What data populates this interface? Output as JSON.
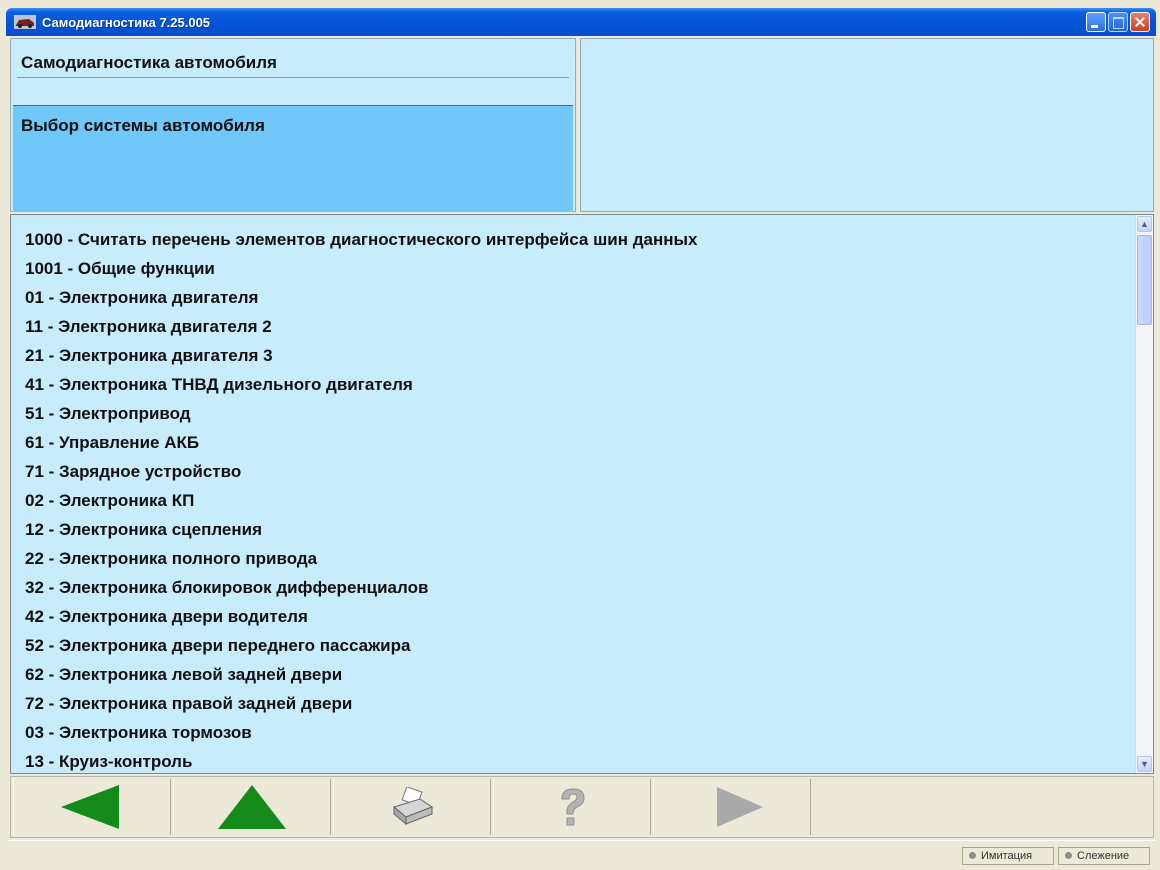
{
  "window": {
    "title": "Самодиагностика 7.25.005"
  },
  "header": {
    "title": "Самодиагностика автомобиля",
    "selected": "Выбор системы автомобиля"
  },
  "list": {
    "items": [
      "1000 - Считать перечень элементов диагностического интерфейса шин данных",
      "1001 - Общие функции",
      "01 - Электроника двигателя",
      "11 - Электроника двигателя 2",
      "21 - Электроника двигателя 3",
      "41 - Электроника ТНВД дизельного двигателя",
      "51 - Электропривод",
      "61 - Управление АКБ",
      "71 - Зарядное устройство",
      "02 - Электроника КП",
      "12 - Электроника сцепления",
      "22 - Электроника полного привода",
      "32 - Электроника блокировок дифференциалов",
      "42 - Электроника двери водителя",
      "52 - Электроника двери переднего пассажира",
      "62 - Электроника левой задней двери",
      "72 - Электроника правой задней двери",
      "03 - Электроника тормозов",
      "13 - Круиз-контроль"
    ]
  },
  "toolbar": {
    "buttons": [
      {
        "icon": "back-arrow-icon",
        "enabled": true,
        "color": "#138a1a"
      },
      {
        "icon": "up-arrow-icon",
        "enabled": true,
        "color": "#138a1a"
      },
      {
        "icon": "printer-icon",
        "enabled": true
      },
      {
        "icon": "help-icon",
        "enabled": false
      },
      {
        "icon": "forward-arrow-icon",
        "enabled": false,
        "color": "#a9a9a9"
      }
    ]
  },
  "status": {
    "imitation": "Имитация",
    "tracking": "Слежение"
  },
  "colors": {
    "panel_bg": "#c8ecfb",
    "selected_bg": "#6fc8f8",
    "titlebar": "#0455d6"
  }
}
